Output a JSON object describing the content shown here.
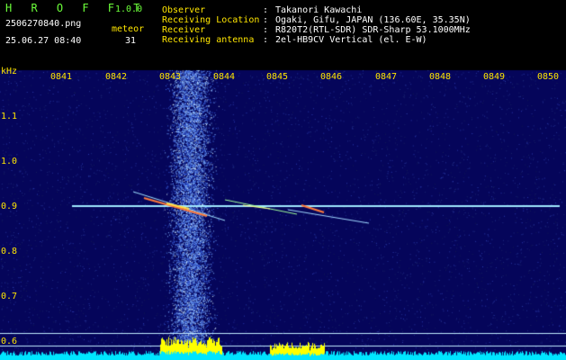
{
  "app": {
    "logo": "H R O F F T",
    "version": "1.0.0",
    "filename": "2506270840.png",
    "datetime": "25.06.27 08:40",
    "meteor_label": "meteor",
    "meteor_count": "31"
  },
  "info": {
    "rows": [
      {
        "label": "Observer",
        "sep": ":",
        "value": "Takanori Kawachi"
      },
      {
        "label": "Receiving Location",
        "sep": ":",
        "value": "Ogaki, Gifu, JAPAN (136.60E, 35.35N)"
      },
      {
        "label": "Receiver",
        "sep": ":",
        "value": "R820T2(RTL-SDR) SDR-Sharp 53.1000MHz"
      },
      {
        "label": "Receiving antenna",
        "sep": ":",
        "value": "2el-HB9CV Vertical (el. E-W)"
      }
    ]
  },
  "axes": {
    "y_unit": "kHz",
    "y_ticks": [
      "1.1",
      "1.0",
      "0.9",
      "0.8",
      "0.7",
      "0.6"
    ],
    "x_ticks": [
      "0841",
      "0842",
      "0843",
      "0844",
      "0845",
      "0846",
      "0847",
      "0848",
      "0849",
      "0850"
    ]
  },
  "colors": {
    "background": "#000000",
    "plot_bg": "#05055a",
    "carrier": "#a0e8ff",
    "text_green": "#6cff3a",
    "text_yellow": "#ffe600",
    "power_bar": "#00e5ff",
    "power_peak": "#ffff00"
  }
}
